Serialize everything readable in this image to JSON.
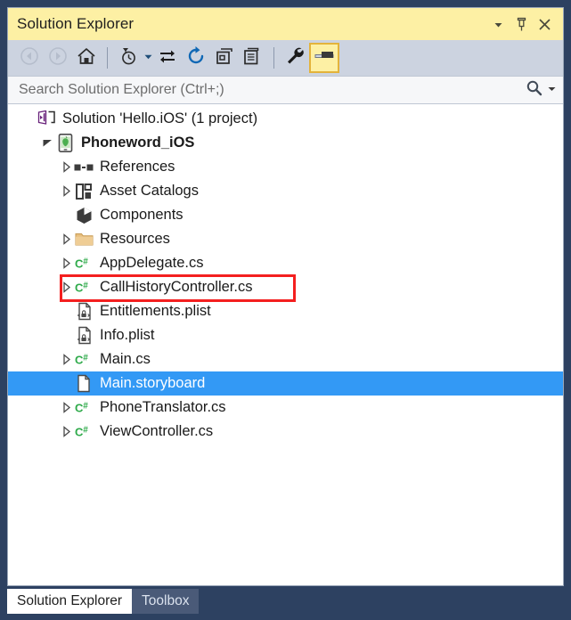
{
  "window": {
    "title": "Solution Explorer"
  },
  "titlebar": {
    "buttons": [
      {
        "name": "window-menu-dropdown",
        "icon": "chevron-down-icon",
        "label": "▼"
      },
      {
        "name": "pin-button",
        "icon": "pin-icon",
        "label": "Pin"
      },
      {
        "name": "close-button",
        "icon": "close-icon",
        "label": "Close"
      }
    ]
  },
  "toolbar": {
    "buttons": [
      {
        "name": "back-button",
        "icon": "back-arrow-icon",
        "tooltip": "Back",
        "enabled": false
      },
      {
        "name": "forward-button",
        "icon": "forward-arrow-icon",
        "tooltip": "Forward",
        "enabled": false
      },
      {
        "name": "home-button",
        "icon": "home-icon",
        "tooltip": "Home",
        "enabled": true
      },
      {
        "name": "pending-changes-button",
        "icon": "clock-filter-icon",
        "tooltip": "Pending Changes Filter",
        "enabled": true
      },
      {
        "name": "pending-changes-dropdown",
        "icon": "chevron-down-icon",
        "tooltip": "Filter options",
        "enabled": true
      },
      {
        "name": "sync-with-active-document-button",
        "icon": "sync-arrows-icon",
        "tooltip": "Sync with Active Document",
        "enabled": true
      },
      {
        "name": "refresh-button",
        "icon": "refresh-icon",
        "tooltip": "Refresh",
        "enabled": true
      },
      {
        "name": "collapse-all-button",
        "icon": "collapse-all-icon",
        "tooltip": "Collapse All",
        "enabled": true
      },
      {
        "name": "show-all-files-button",
        "icon": "show-all-files-icon",
        "tooltip": "Show All Files",
        "enabled": true
      },
      {
        "name": "properties-button",
        "icon": "wrench-icon",
        "tooltip": "Properties",
        "enabled": true
      },
      {
        "name": "preview-selected-items-button",
        "icon": "preview-pane-icon",
        "tooltip": "Preview Selected Items",
        "enabled": true,
        "active": true
      }
    ]
  },
  "search": {
    "placeholder": "Search Solution Explorer (Ctrl+;)",
    "value": "",
    "icon": "search-icon",
    "dropdown_icon": "chevron-down-icon"
  },
  "tree": {
    "items": [
      {
        "label": "Solution 'Hello.iOS' (1 project)",
        "icon": "visual-studio-solution-icon",
        "indent": 0,
        "twisty": "none",
        "bold": false,
        "selected": false
      },
      {
        "label": "Phoneword_iOS",
        "icon": "ios-project-icon",
        "indent": 1,
        "twisty": "expanded",
        "bold": true,
        "selected": false
      },
      {
        "label": "References",
        "icon": "references-icon",
        "indent": 2,
        "twisty": "collapsed",
        "bold": false,
        "selected": false
      },
      {
        "label": "Asset Catalogs",
        "icon": "asset-catalog-icon",
        "indent": 2,
        "twisty": "collapsed",
        "bold": false,
        "selected": false
      },
      {
        "label": "Components",
        "icon": "components-icon",
        "indent": 2,
        "twisty": "none",
        "bold": false,
        "selected": false
      },
      {
        "label": "Resources",
        "icon": "folder-icon",
        "indent": 2,
        "twisty": "collapsed",
        "bold": false,
        "selected": false
      },
      {
        "label": "AppDelegate.cs",
        "icon": "csharp-file-icon",
        "indent": 2,
        "twisty": "collapsed",
        "bold": false,
        "selected": false
      },
      {
        "label": "CallHistoryController.cs",
        "icon": "csharp-file-icon",
        "indent": 2,
        "twisty": "collapsed",
        "bold": false,
        "selected": false,
        "highlighted": true
      },
      {
        "label": "Entitlements.plist",
        "icon": "plist-file-icon",
        "indent": 2,
        "twisty": "none",
        "bold": false,
        "selected": false
      },
      {
        "label": "Info.plist",
        "icon": "plist-file-icon",
        "indent": 2,
        "twisty": "none",
        "bold": false,
        "selected": false
      },
      {
        "label": "Main.cs",
        "icon": "csharp-file-icon",
        "indent": 2,
        "twisty": "collapsed",
        "bold": false,
        "selected": false
      },
      {
        "label": "Main.storyboard",
        "icon": "storyboard-file-icon",
        "indent": 2,
        "twisty": "none",
        "bold": false,
        "selected": true
      },
      {
        "label": "PhoneTranslator.cs",
        "icon": "csharp-file-icon",
        "indent": 2,
        "twisty": "collapsed",
        "bold": false,
        "selected": false
      },
      {
        "label": "ViewController.cs",
        "icon": "csharp-file-icon",
        "indent": 2,
        "twisty": "collapsed",
        "bold": false,
        "selected": false
      }
    ]
  },
  "annotation": {
    "target_label": "CallHistoryController.cs",
    "box_color": "#f41f1f"
  },
  "tabs": [
    {
      "label": "Solution Explorer",
      "active": true
    },
    {
      "label": "Toolbox",
      "active": false
    }
  ],
  "colors": {
    "titlebar_background": "#fdf0a4",
    "toolbar_background": "#ccd3e0",
    "selection_blue": "#3399f5",
    "annotation_red": "#f41f1f",
    "window_chrome": "#2d4161",
    "csharp_green": "#2eaa4a"
  }
}
